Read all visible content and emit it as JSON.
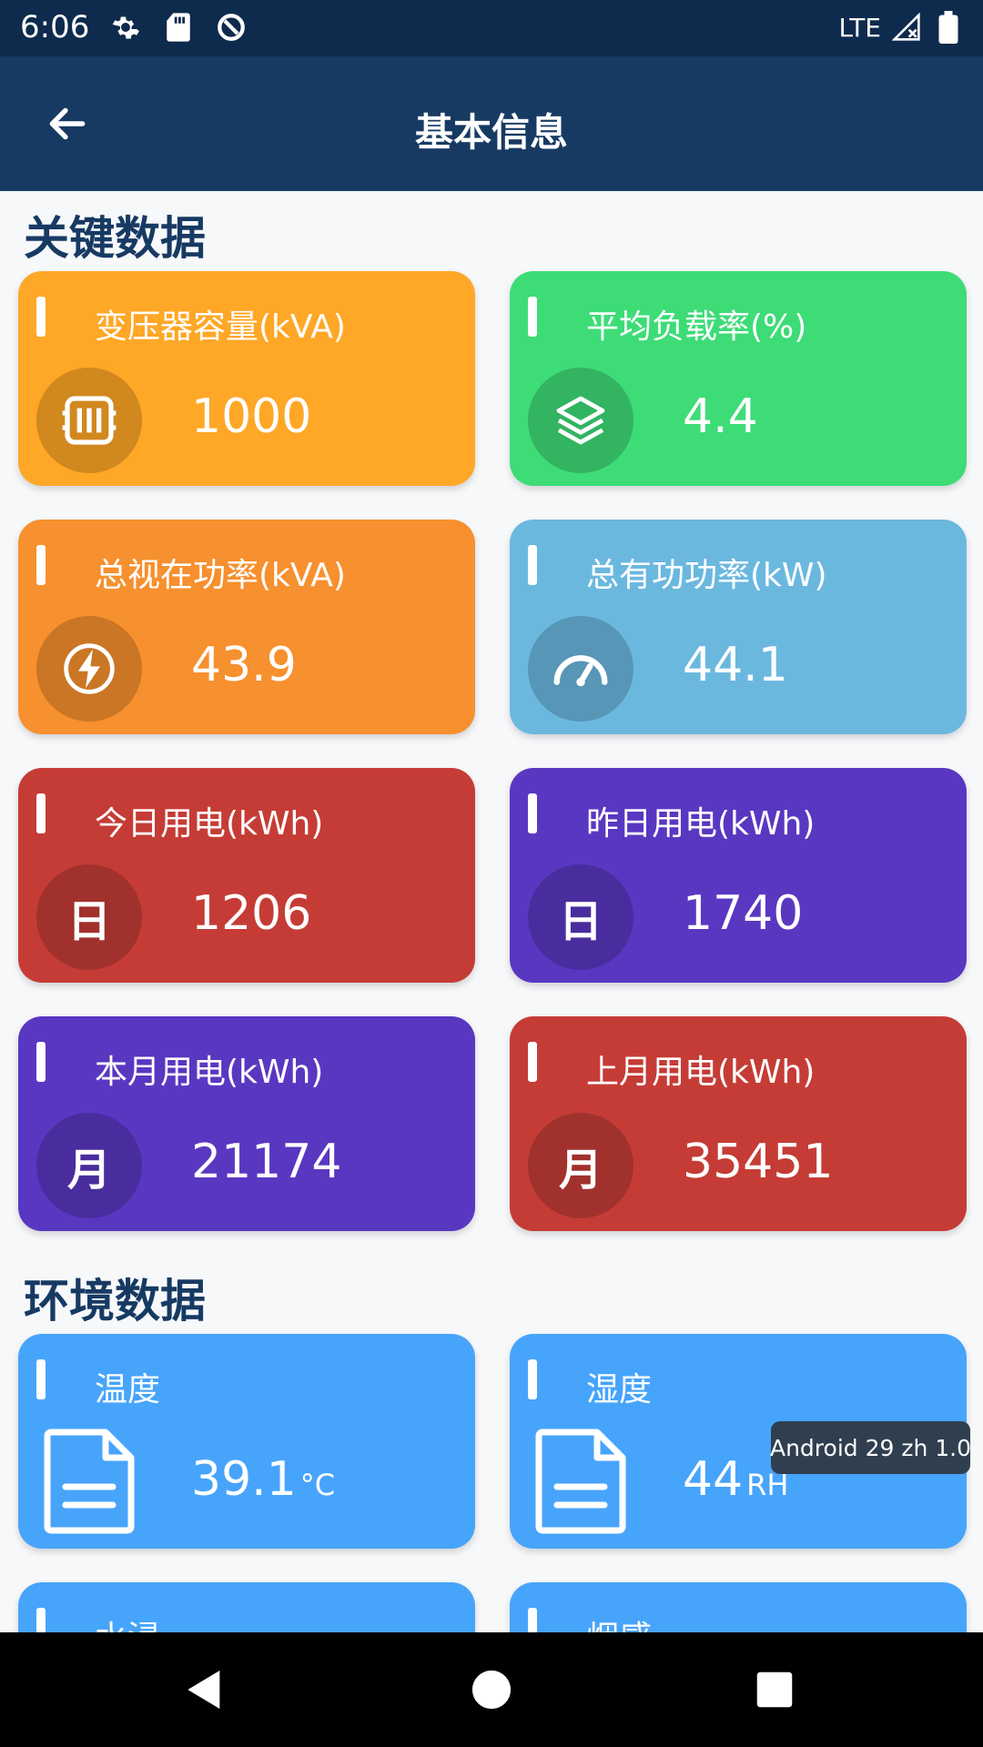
{
  "status_bar": {
    "time": "6:06",
    "network": "LTE"
  },
  "app_bar": {
    "title": "基本信息"
  },
  "sections": {
    "key_data_title": "关键数据",
    "env_data_title": "环境数据"
  },
  "key_cards": [
    {
      "label": "变压器容量(kVA)",
      "value": "1000",
      "icon": "transformer-icon",
      "color": "#ffa726"
    },
    {
      "label": "平均负载率(%)",
      "value": "4.4",
      "icon": "layers-icon",
      "color": "#3ddc77"
    },
    {
      "label": "总视在功率(kVA)",
      "value": "43.9",
      "icon": "lightning-icon",
      "color": "#f7902e"
    },
    {
      "label": "总有功功率(kW)",
      "value": "44.1",
      "icon": "speedometer-icon",
      "color": "#6bb8df"
    },
    {
      "label": "今日用电(kWh)",
      "value": "1206",
      "icon_char": "日",
      "color": "#c53c36"
    },
    {
      "label": "昨日用电(kWh)",
      "value": "1740",
      "icon_char": "日",
      "color": "#5a37c1"
    },
    {
      "label": "本月用电(kWh)",
      "value": "21174",
      "icon_char": "月",
      "color": "#5a37c1"
    },
    {
      "label": "上月用电(kWh)",
      "value": "35451",
      "icon_char": "月",
      "color": "#c53c36"
    }
  ],
  "env_cards": [
    {
      "label": "温度",
      "value": "39.1",
      "unit": "°C",
      "icon": "document-icon",
      "color": "#47a4fb"
    },
    {
      "label": "湿度",
      "value": "44",
      "unit": "RH",
      "icon": "document-icon",
      "color": "#47a4fb"
    },
    {
      "label": "水浸",
      "color": "#47a4fb"
    },
    {
      "label": "烟感",
      "color": "#47a4fb"
    }
  ],
  "tooltip": "Android 29 zh 1.0"
}
